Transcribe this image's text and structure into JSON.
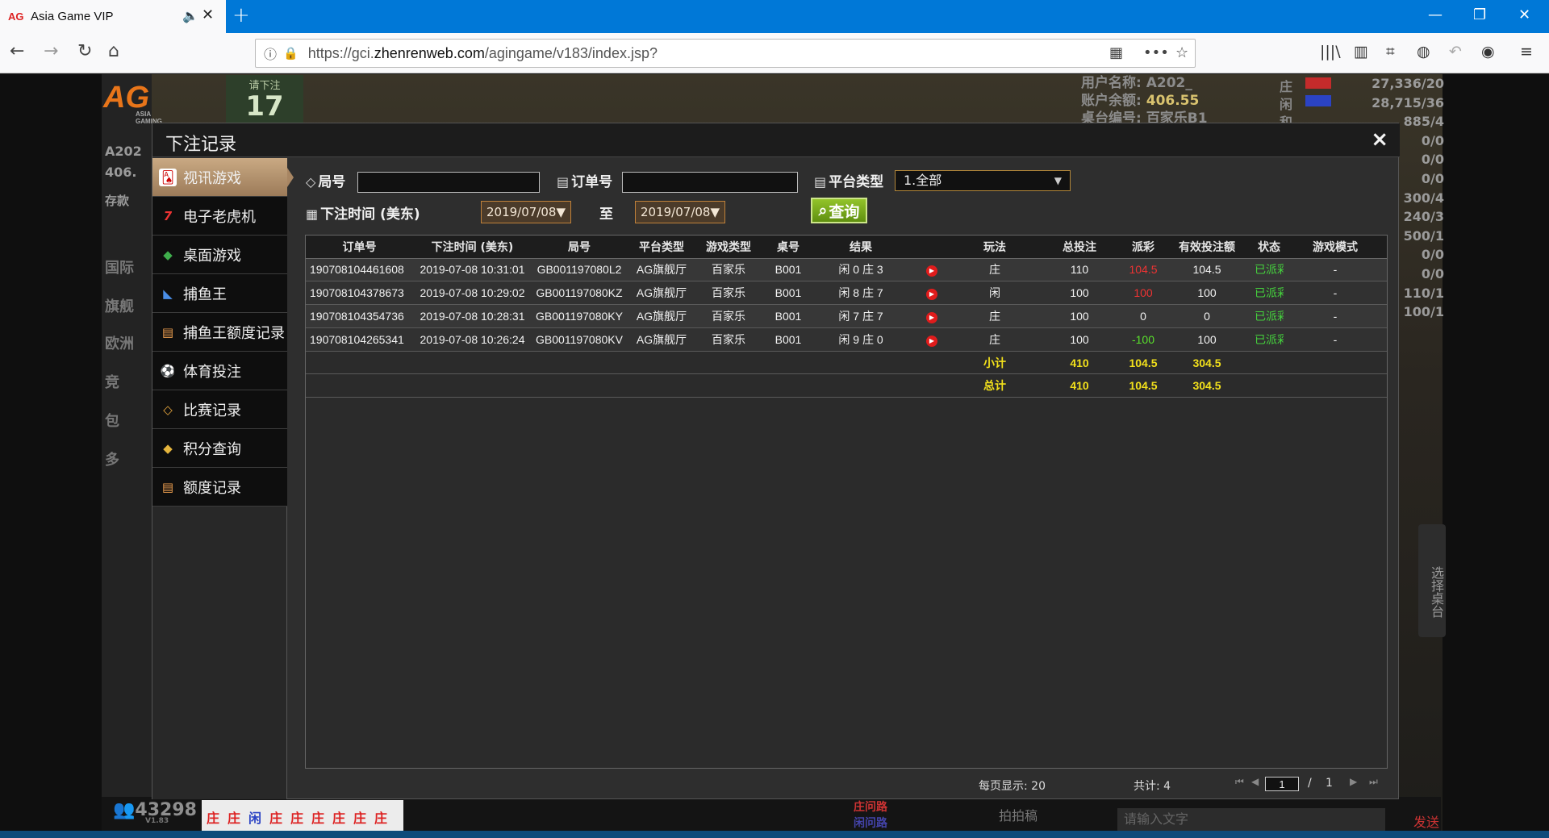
{
  "browser": {
    "tab_title": "Asia Game VIP",
    "tab_favicon": "AG",
    "url_prefix": "https://gci.",
    "url_domain": "zhenrenweb.com",
    "url_suffix": "/agingame/v183/index.jsp?"
  },
  "game": {
    "logo": "AG",
    "logo_sub": "ASIA GAMING",
    "countdown_label": "请下注",
    "countdown_value": "17",
    "username_label": "用户名称:",
    "username_value": "A202_",
    "balance_label": "账户余额:",
    "balance_value": "406.55",
    "table_label": "桌台编号:",
    "table_value": "百家乐B1",
    "road_labels": [
      "庄",
      "闲",
      "和"
    ],
    "scores": [
      "27,336/20",
      "28,715/36",
      "885/4",
      "0/0",
      "0/0",
      "0/0",
      "300/4",
      "240/3",
      "500/1",
      "0/0",
      "0/0",
      "110/1",
      "100/1"
    ],
    "left_user": "A202",
    "left_balance": "406.",
    "left_deposit": "存款",
    "left_items": [
      "国际",
      "旗舰",
      "欧洲",
      "竞",
      "包",
      "多"
    ],
    "bottom_score": "43298",
    "bottom_version": "V1.83",
    "bottom_road": [
      "庄",
      "庄",
      "闲",
      "庄",
      "庄",
      "庄",
      "庄",
      "庄",
      "庄"
    ],
    "road_query_zhuang": "庄问路",
    "road_query_xian": "闲问路",
    "chat_placeholder": "请输入文字",
    "chat_send": "发送",
    "pai_pai": "拍拍稿",
    "side_tab": "选择桌台"
  },
  "modal": {
    "title": "下注记录",
    "close": "×",
    "sidebar": [
      {
        "label": "视讯游戏",
        "icon": "cards-icon",
        "glyph": "🂡",
        "active": true
      },
      {
        "label": "电子老虎机",
        "icon": "slot-machine-icon",
        "glyph": "7"
      },
      {
        "label": "桌面游戏",
        "icon": "chip-icon",
        "glyph": "◆"
      },
      {
        "label": "捕鱼王",
        "icon": "fish-icon",
        "glyph": "◣"
      },
      {
        "label": "捕鱼王额度记录",
        "icon": "document-icon",
        "glyph": "▤"
      },
      {
        "label": "体育投注",
        "icon": "sports-icon",
        "glyph": "⚽"
      },
      {
        "label": "比赛记录",
        "icon": "ticket-icon",
        "glyph": "◇"
      },
      {
        "label": "积分查询",
        "icon": "diamond-icon",
        "glyph": "◆"
      },
      {
        "label": "额度记录",
        "icon": "document-icon",
        "glyph": "▤"
      }
    ],
    "filters": {
      "round_label": "局号",
      "round_value": "",
      "order_label": "订单号",
      "order_value": "",
      "platform_label": "平台类型",
      "platform_value": "1.全部",
      "time_label": "下注时间 (美东)",
      "date_from": "2019/07/08▼",
      "to_label": "至",
      "date_to": "2019/07/08▼",
      "query_label": "查询"
    },
    "table": {
      "headers": [
        "订单号",
        "下注时间 (美东)",
        "局号",
        "平台类型",
        "游戏类型",
        "桌号",
        "结果",
        "",
        "玩法",
        "总投注",
        "派彩",
        "有效投注额",
        "状态",
        "游戏模式"
      ],
      "rows": [
        {
          "order": "190708104461608",
          "time": "2019-07-08 10:31:01",
          "round": "GB001197080L2",
          "platform": "AG旗舰厅",
          "game": "百家乐",
          "table": "B001",
          "result": "闲 0 庄 3",
          "play": "庄",
          "total": "110",
          "payout": "104.5",
          "payout_kind": "red",
          "valid": "104.5",
          "status": "已派彩",
          "mode": "-"
        },
        {
          "order": "190708104378673",
          "time": "2019-07-08 10:29:02",
          "round": "GB001197080KZ",
          "platform": "AG旗舰厅",
          "game": "百家乐",
          "table": "B001",
          "result": "闲 8 庄 7",
          "play": "闲",
          "total": "100",
          "payout": "100",
          "payout_kind": "red",
          "valid": "100",
          "status": "已派彩",
          "mode": "-"
        },
        {
          "order": "190708104354736",
          "time": "2019-07-08 10:28:31",
          "round": "GB001197080KY",
          "platform": "AG旗舰厅",
          "game": "百家乐",
          "table": "B001",
          "result": "闲 7 庄 7",
          "play": "庄",
          "total": "100",
          "payout": "0",
          "payout_kind": "plain",
          "valid": "0",
          "status": "已派彩",
          "mode": "-"
        },
        {
          "order": "190708104265341",
          "time": "2019-07-08 10:26:24",
          "round": "GB001197080KV",
          "platform": "AG旗舰厅",
          "game": "百家乐",
          "table": "B001",
          "result": "闲 9 庄 0",
          "play": "庄",
          "total": "100",
          "payout": "-100",
          "payout_kind": "green",
          "valid": "100",
          "status": "已派彩",
          "mode": "-"
        }
      ],
      "subtotal": {
        "label": "小计",
        "total": "410",
        "payout": "104.5",
        "valid": "304.5"
      },
      "grand_total": {
        "label": "总计",
        "total": "410",
        "payout": "104.5",
        "valid": "304.5"
      }
    },
    "footer": {
      "per_page": "每页显示: 20",
      "total": "共计: 4",
      "current_page": "1",
      "separator": "/",
      "page_count": "1"
    }
  }
}
